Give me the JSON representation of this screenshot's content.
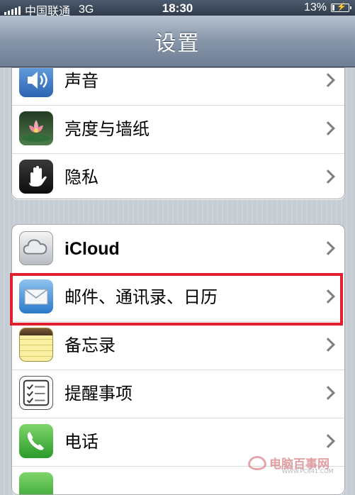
{
  "status_bar": {
    "carrier": "中国联通",
    "network": "3G",
    "time": "18:30",
    "battery": "13%",
    "battery_level": 0.13
  },
  "nav": {
    "title": "设置"
  },
  "group1": [
    {
      "label": "声音",
      "icon": "speaker-icon"
    },
    {
      "label": "亮度与墙纸",
      "icon": "flower-icon"
    },
    {
      "label": "隐私",
      "icon": "hand-icon"
    }
  ],
  "group2": [
    {
      "label": "iCloud",
      "icon": "cloud-icon"
    },
    {
      "label": "邮件、通讯录、日历",
      "icon": "mail-icon"
    },
    {
      "label": "备忘录",
      "icon": "notepad-icon"
    },
    {
      "label": "提醒事项",
      "icon": "checklist-icon"
    },
    {
      "label": "电话",
      "icon": "phone-icon"
    }
  ],
  "colors": {
    "highlight": "#e0202e",
    "nav": "#7f8ea3"
  },
  "watermark": {
    "text": "电脑百事网",
    "sub": "WWW.PC841.COM"
  }
}
